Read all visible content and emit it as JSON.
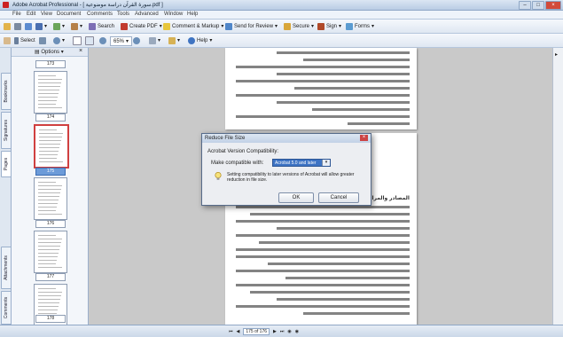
{
  "window": {
    "title": "Adobe Acrobat Professional - [ سورة القرآن دراسة موضوعية.pdf ]"
  },
  "menu": [
    "File",
    "Edit",
    "View",
    "Document",
    "Comments",
    "Tools",
    "Advanced",
    "Window",
    "Help"
  ],
  "toolbar1": {
    "search": "Search",
    "create_pdf": "Create PDF",
    "comment_markup": "Comment & Markup",
    "send_review": "Send for Review",
    "secure": "Secure",
    "sign": "Sign",
    "forms": "Forms"
  },
  "toolbar2": {
    "select": "Select",
    "zoom": "65%",
    "help": "Help"
  },
  "panel": {
    "options": "Options",
    "close": "×",
    "pages": [
      "173",
      "174",
      "175",
      "176",
      "177",
      "178"
    ],
    "selected_page": "175"
  },
  "side_tabs": {
    "bookmarks": "Bookmarks",
    "signatures": "Signatures",
    "pages": "Pages",
    "attachments": "Attachments",
    "comments": "Comments"
  },
  "document": {
    "heading": "المصادر والمراجع"
  },
  "status": {
    "page_display": "175 of 176"
  },
  "dialog": {
    "title": "Reduce File Size",
    "section": "Acrobat Version Compatibility:",
    "label": "Make compatible with:",
    "selected": "Acrobat 5.0 and later",
    "info": "Setting compatibility to later versions of Acrobat will allow greater reduction in file size.",
    "ok": "OK",
    "cancel": "Cancel"
  }
}
